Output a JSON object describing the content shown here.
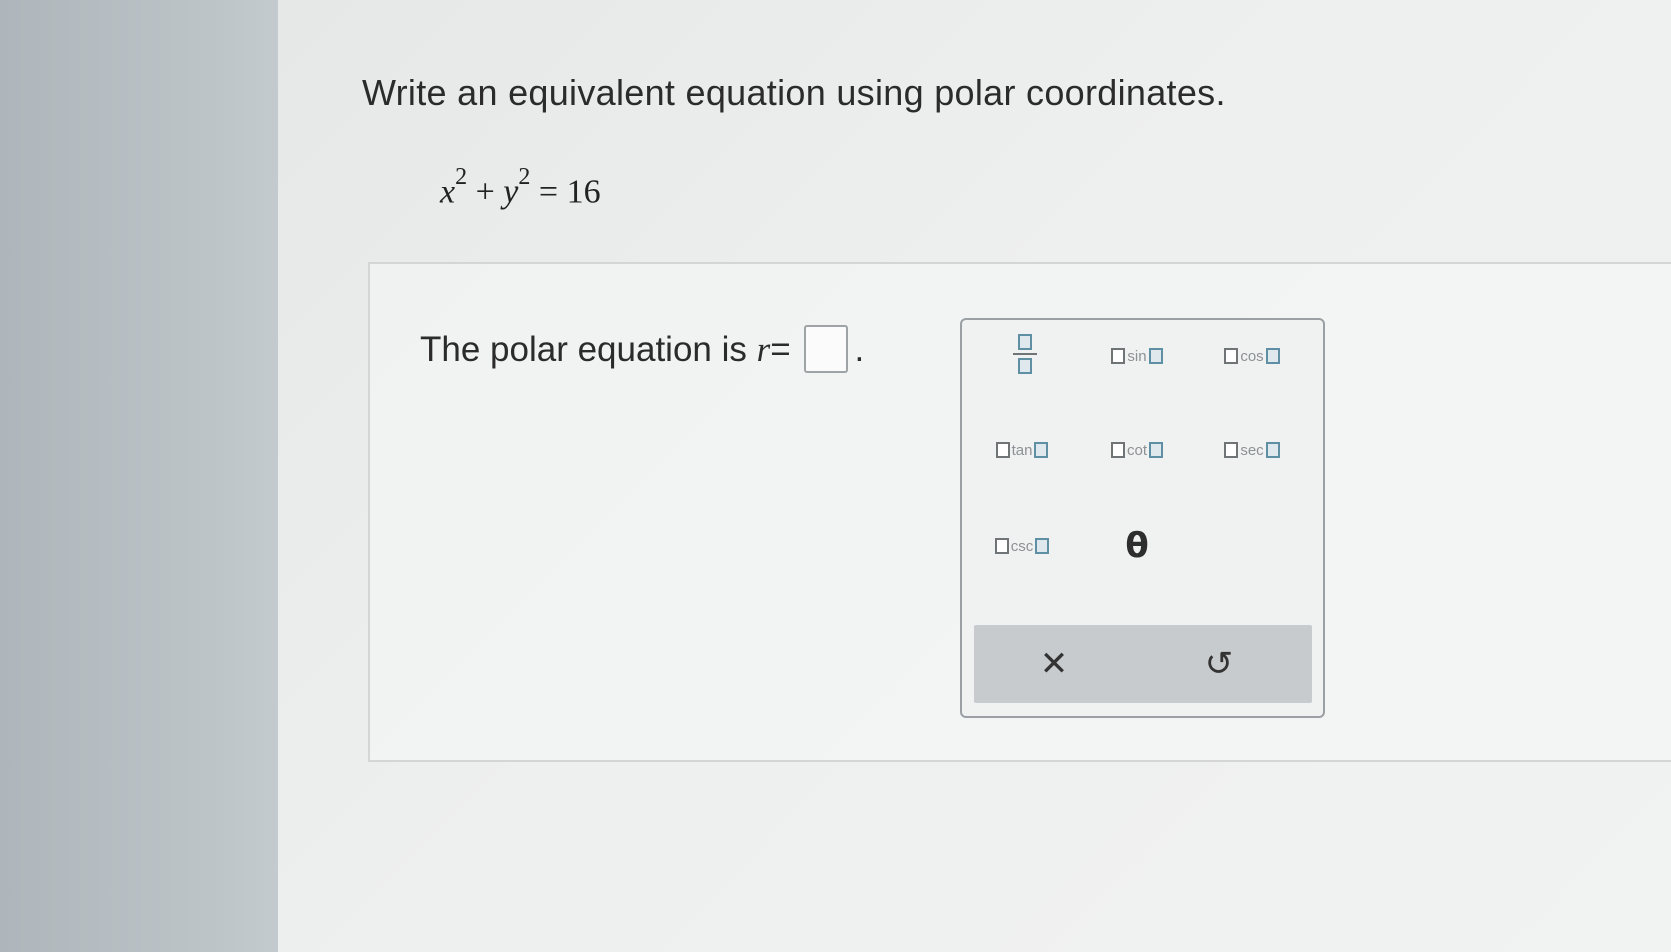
{
  "question": {
    "title": "Write an equivalent equation using polar coordinates.",
    "equation": {
      "x": "x",
      "exp1": "2",
      "plus": "+",
      "y": "y",
      "exp2": "2",
      "eq": "=",
      "rhs": "16"
    }
  },
  "answer": {
    "prompt_text": "The polar equation is",
    "r_var": "r",
    "equals": "=",
    "period": "."
  },
  "palette": {
    "functions": [
      "sin",
      "cos",
      "tan",
      "cot",
      "sec",
      "csc"
    ],
    "theta": "θ",
    "clear_symbol": "✕",
    "undo_symbol": "↺"
  }
}
